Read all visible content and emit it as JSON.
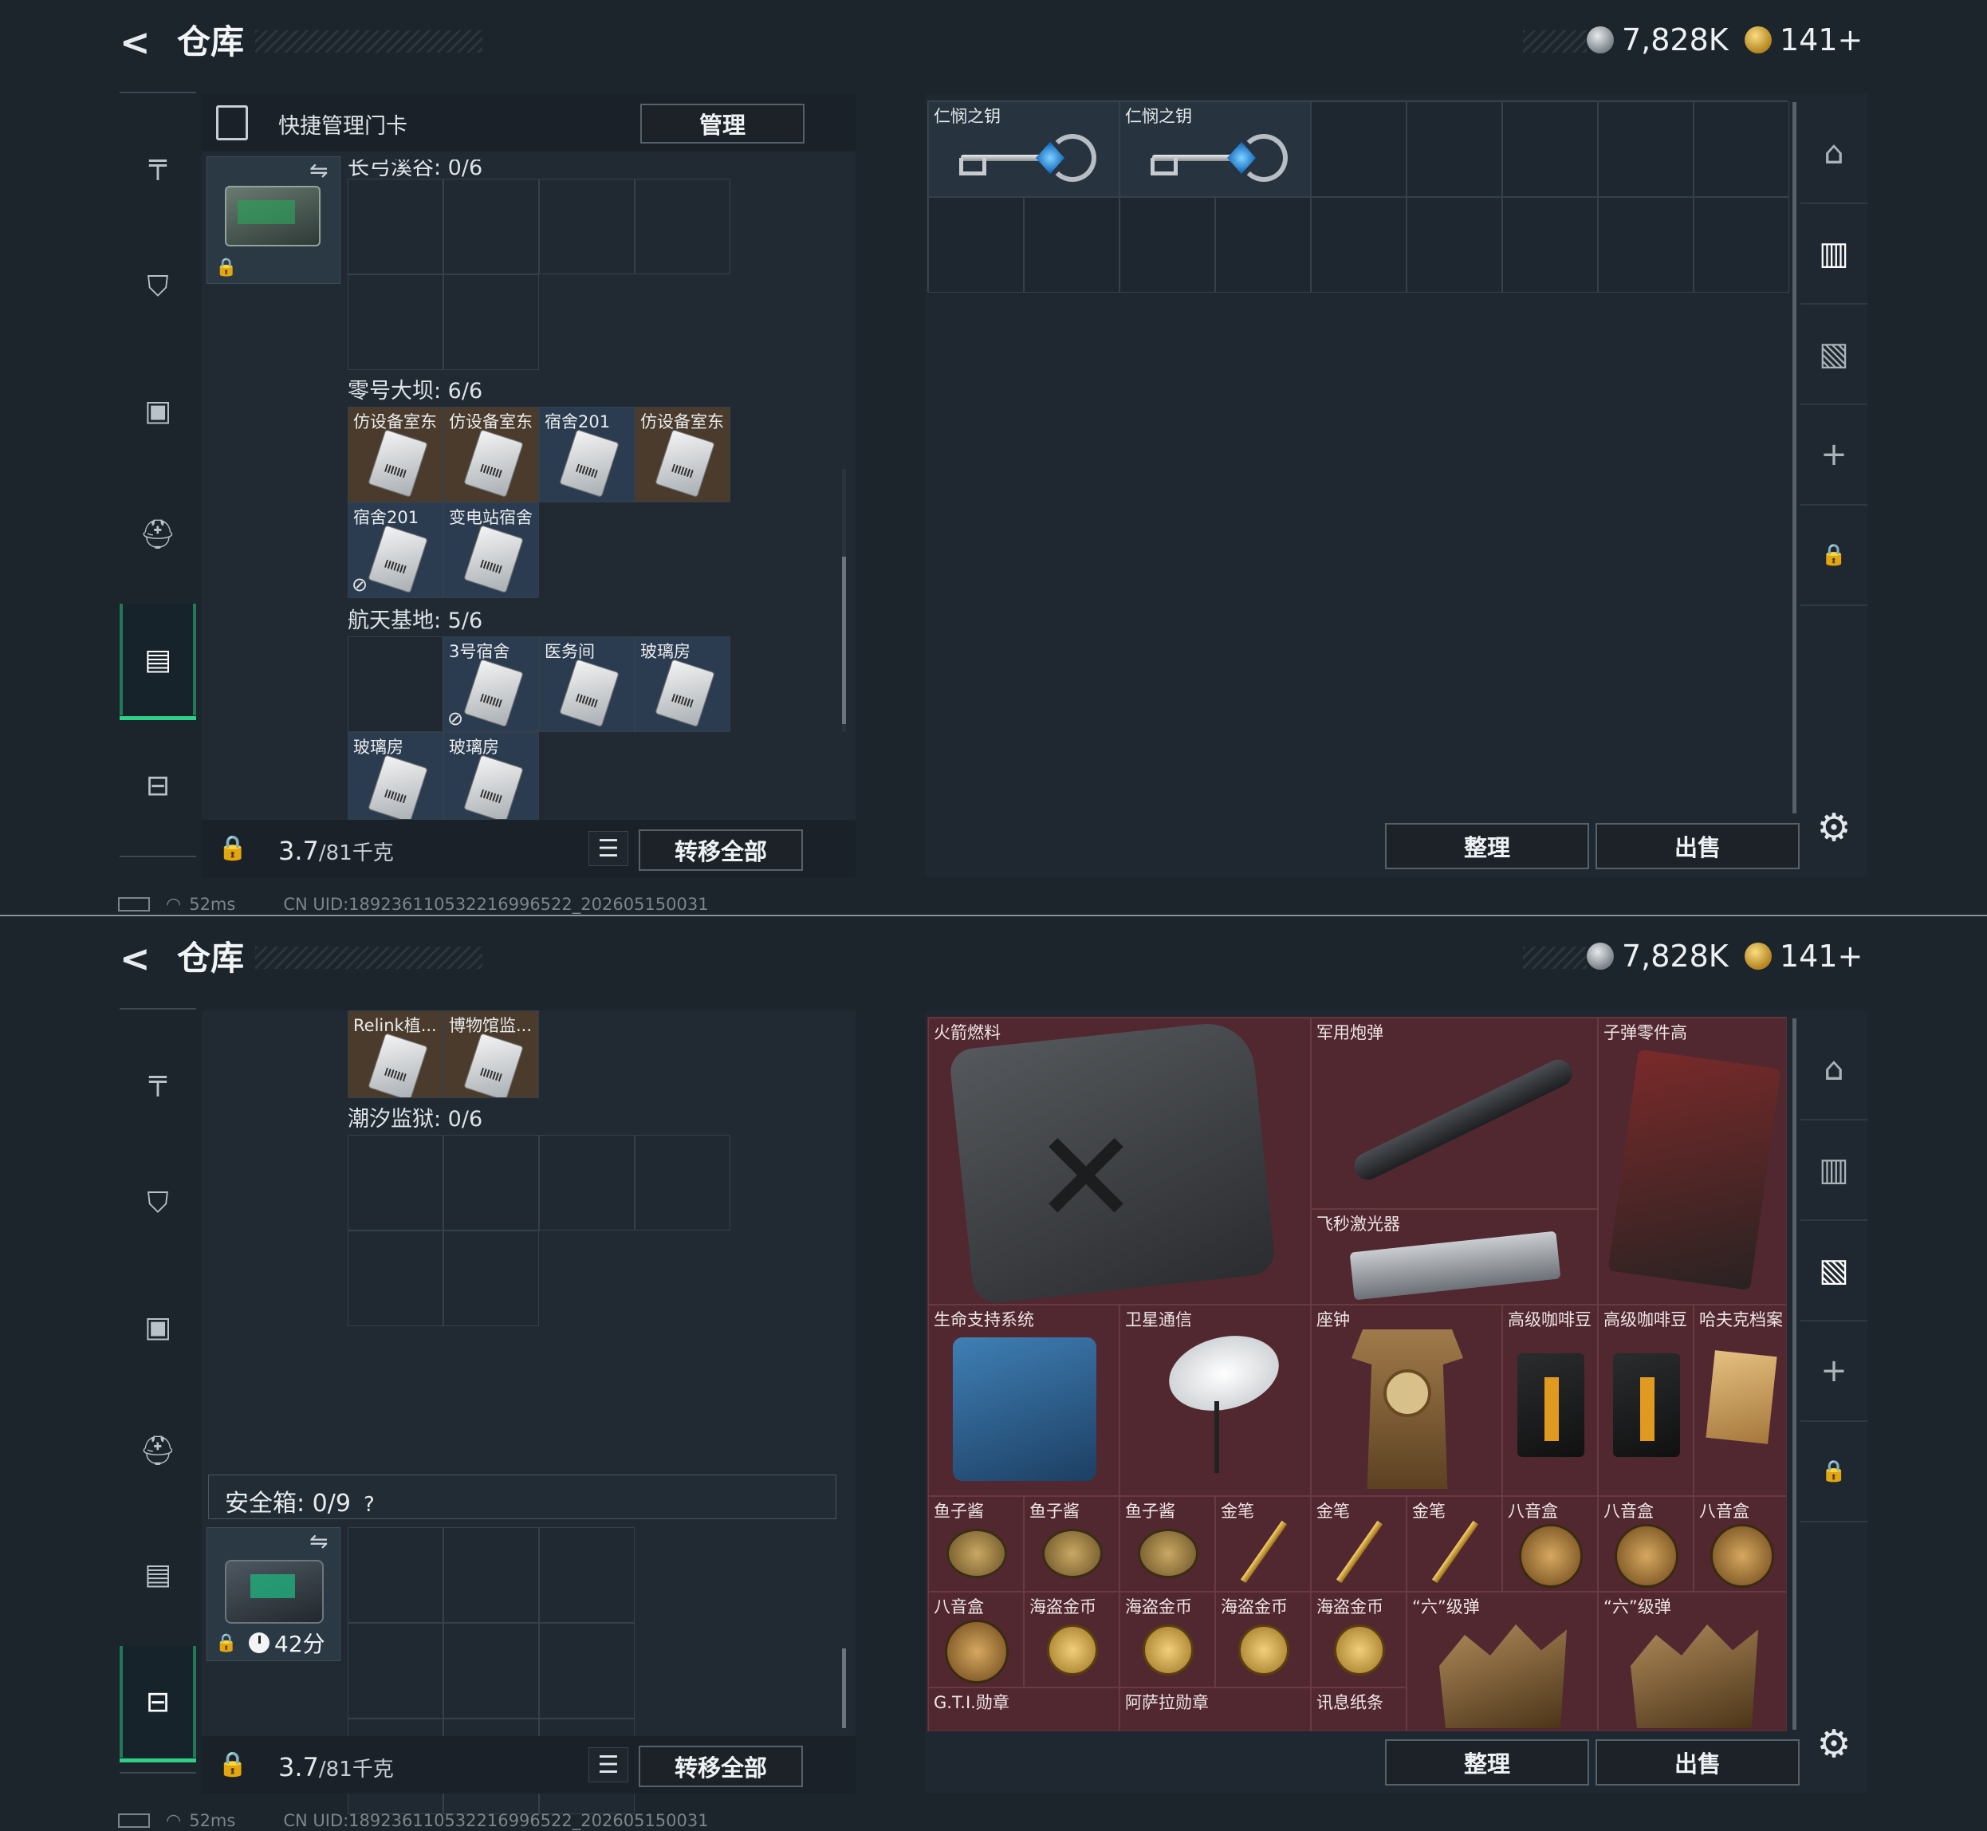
{
  "header": {
    "title": "仓库",
    "currency_silver": "7,828K",
    "currency_gold": "141+"
  },
  "nav": {
    "items": [
      {
        "id": "gun",
        "icon": "gun-icon",
        "glyph": "╤"
      },
      {
        "id": "armor",
        "icon": "armor-vest-icon",
        "glyph": "⛉"
      },
      {
        "id": "backpack",
        "icon": "backpack-icon",
        "glyph": "▣"
      },
      {
        "id": "helmet",
        "icon": "helmet-icon",
        "glyph": "⛑"
      },
      {
        "id": "keycard",
        "icon": "keycard-case-icon",
        "glyph": "▤"
      },
      {
        "id": "safebox",
        "icon": "briefcase-icon",
        "glyph": "⊟"
      }
    ]
  },
  "top": {
    "header_label": "快捷管理门卡",
    "manage_button": "管理",
    "sections": [
      {
        "label": "长弓溪谷: 0/6"
      },
      {
        "label": "零号大坝: 6/6"
      },
      {
        "label": "航天基地: 5/6"
      }
    ],
    "dam_cards": [
      "仿设备室东",
      "仿设备室东",
      "宿舍201",
      "仿设备室东",
      "宿舍201",
      "变电站宿舍"
    ],
    "base_cards": [
      "",
      "3号宿舍",
      "医务间",
      "玻璃房",
      "玻璃房",
      "玻璃房"
    ],
    "weight": "3.7",
    "weight_max": "/81千克",
    "transfer_button": "转移全部",
    "keys": [
      "仁悯之钥",
      "仁悯之钥"
    ]
  },
  "bottom": {
    "top_cards": [
      "Relink植...",
      "博物馆监..."
    ],
    "section_label": "潮汐监狱: 0/6",
    "safe_label": "安全箱: 0/9",
    "safe_help": "?",
    "safe_timer": "42分",
    "weight": "3.7",
    "weight_max": "/81千克",
    "transfer_button": "转移全部",
    "loot": {
      "fuel": "火箭燃料",
      "shell": "军用炮弹",
      "parts": "子弹零件高",
      "laser": "飞秒激光器",
      "life": "生命支持系统",
      "sat": "卫星通信",
      "clock": "座钟",
      "coffee1": "高级咖啡豆",
      "coffee2": "高级咖啡豆",
      "file": "哈夫克档案",
      "caviar1": "鱼子酱",
      "caviar2": "鱼子酱",
      "caviar3": "鱼子酱",
      "pen1": "金笔",
      "pen2": "金笔",
      "pen3": "金笔",
      "music1": "八音盒",
      "music2": "八音盒",
      "music3": "八音盒",
      "music4": "八音盒",
      "coin1": "海盗金币",
      "coin2": "海盗金币",
      "coin3": "海盗金币",
      "coin4": "海盗金币",
      "ammo1": "“六”级弹",
      "ammo2": "“六”级弹",
      "medal1": "G.T.I.勋章",
      "medal2": "阿萨拉勋章",
      "note": "讯息纸条"
    }
  },
  "actions": {
    "sort_button": "整理",
    "sell_button": "出售"
  },
  "status": {
    "ping": "52ms",
    "uid": "CN UID:1892361105322169965​22_202605150031"
  }
}
